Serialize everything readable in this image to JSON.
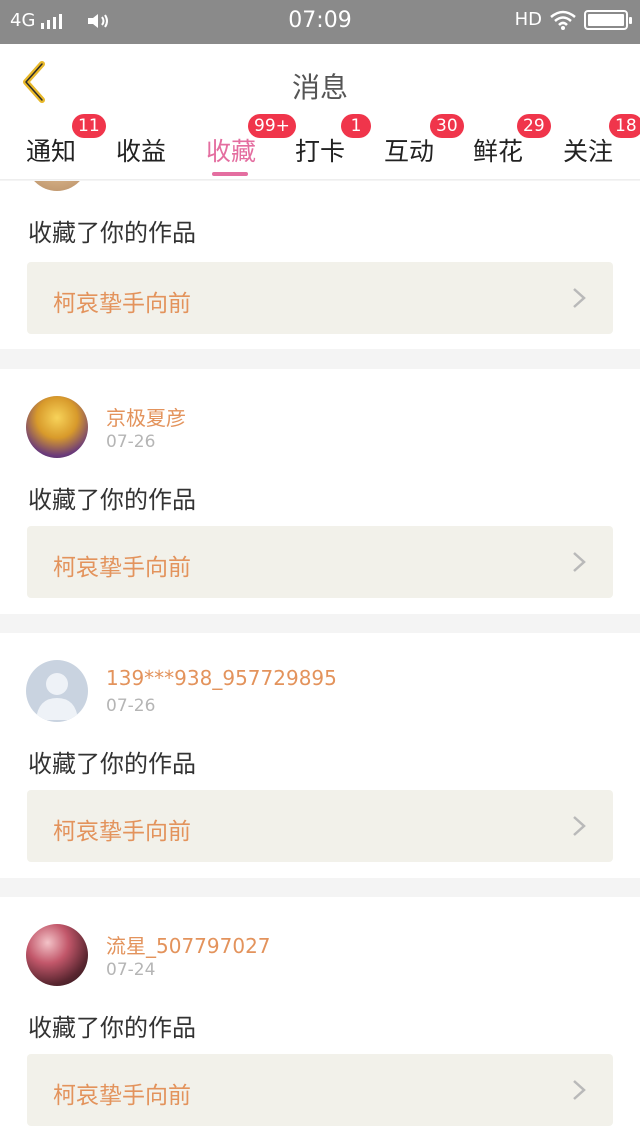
{
  "status_bar": {
    "network": "4G",
    "time": "07:09",
    "hd": "HD"
  },
  "header": {
    "title": "消息",
    "back_icon": "chevron-left-icon"
  },
  "tabs": [
    {
      "label": "通知",
      "badge": "11",
      "active": false
    },
    {
      "label": "收益",
      "badge": "",
      "active": false
    },
    {
      "label": "收藏",
      "badge": "99+",
      "active": true
    },
    {
      "label": "打卡",
      "badge": "1",
      "active": false
    },
    {
      "label": "互动",
      "badge": "30",
      "active": false
    },
    {
      "label": "鲜花",
      "badge": "29",
      "active": false
    },
    {
      "label": "关注",
      "badge": "18",
      "active": false
    }
  ],
  "items": [
    {
      "user": "",
      "date": "",
      "action": "收藏了你的作品",
      "work_title": "柯哀挚手向前"
    },
    {
      "user": "京极夏彦",
      "date": "07-26",
      "action": "收藏了你的作品",
      "work_title": "柯哀挚手向前"
    },
    {
      "user": "139***938_957729895",
      "date": "07-26",
      "action": "收藏了你的作品",
      "work_title": "柯哀挚手向前"
    },
    {
      "user": "流星_507797027",
      "date": "07-24",
      "action": "收藏了你的作品",
      "work_title": "柯哀挚手向前"
    }
  ],
  "colors": {
    "accent": "#e46ea0",
    "badge": "#f0354b",
    "username": "#e3935c",
    "back_arrow": "#e8b829"
  }
}
